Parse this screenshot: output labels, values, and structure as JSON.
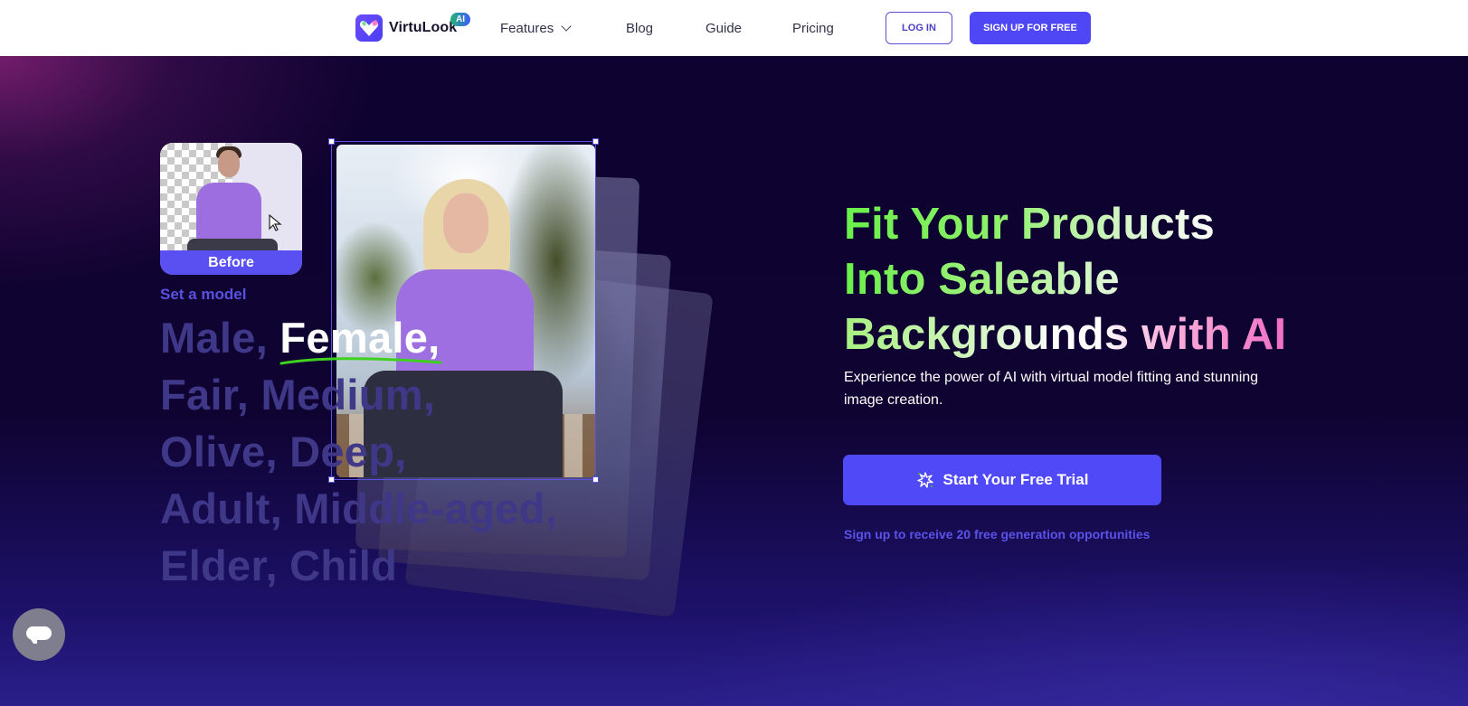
{
  "nav": {
    "brand": "VirtuLook",
    "brand_badge": "AI",
    "links": [
      {
        "label": "Features",
        "has_dropdown": true
      },
      {
        "label": "Blog"
      },
      {
        "label": "Guide"
      },
      {
        "label": "Pricing"
      }
    ],
    "login_label": "LOG IN",
    "signup_label": "SIGN UP FOR FREE"
  },
  "hero": {
    "before_label": "Before",
    "set_model_label": "Set a model",
    "attributes": {
      "line1_a": "Male, ",
      "line1_active": "Female,",
      "line2": "Fair, Medium,",
      "line3": "Olive, Deep,",
      "line4": "Adult, Middle-aged,",
      "line5": "Elder, Child"
    },
    "headline": {
      "line1": "Fit Your Products",
      "line2": "Into Saleable",
      "line3": "Backgrounds with AI"
    },
    "subtext": "Experience the power of AI with virtual model fitting and stunning image creation.",
    "cta_label": "Start Your Free Trial",
    "cta_icon": "sparkle-burst-icon",
    "promo_text": "Sign up to receive 20 free generation opportunities"
  },
  "colors": {
    "brand_primary": "#4f46f5",
    "headline_green": "#6af04a",
    "headline_pink": "#f06ec4",
    "attribute_inactive": "#3f3787",
    "underline_green": "#3fd11f",
    "background_dark": "#0d0228"
  },
  "chat_widget": {
    "icon": "chat-bubble-icon"
  }
}
